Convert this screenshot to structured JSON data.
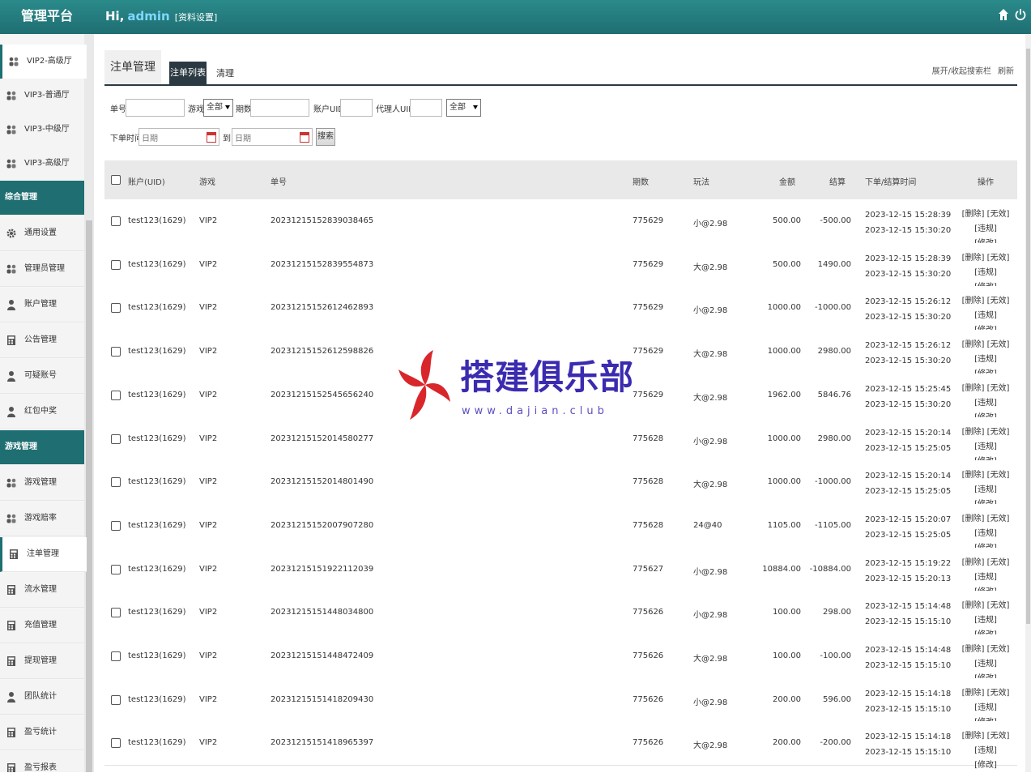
{
  "header": {
    "brand": "管理平台",
    "greeting": "Hi,",
    "user": "admin",
    "profile_link": "[资料设置]"
  },
  "sidebar": {
    "items_top": [
      {
        "label": "VIP2-高级厅",
        "icon": "users-icon"
      },
      {
        "label": "VIP3-普通厅",
        "icon": "users-icon"
      },
      {
        "label": "VIP3-中级厅",
        "icon": "users-icon"
      },
      {
        "label": "VIP3-高级厅",
        "icon": "users-icon"
      }
    ],
    "section1": "综合管理",
    "items_mid": [
      {
        "label": "通用设置",
        "icon": "gear-icon"
      },
      {
        "label": "管理员管理",
        "icon": "users-icon"
      },
      {
        "label": "账户管理",
        "icon": "user-icon"
      },
      {
        "label": "公告管理",
        "icon": "calculator-icon"
      },
      {
        "label": "可疑账号",
        "icon": "user-icon"
      },
      {
        "label": "红包中奖",
        "icon": "user-icon"
      }
    ],
    "section2": "游戏管理",
    "items_bottom": [
      {
        "label": "游戏管理",
        "icon": "users-icon"
      },
      {
        "label": "游戏赔率",
        "icon": "users-icon"
      },
      {
        "label": "注单管理",
        "icon": "calculator-icon"
      },
      {
        "label": "流水管理",
        "icon": "calculator-icon"
      },
      {
        "label": "充值管理",
        "icon": "calculator-icon"
      },
      {
        "label": "提现管理",
        "icon": "calculator-icon"
      },
      {
        "label": "团队统计",
        "icon": "user-icon"
      },
      {
        "label": "盈亏统计",
        "icon": "calculator-icon"
      },
      {
        "label": "盈亏报表",
        "icon": "calculator-icon"
      }
    ]
  },
  "tabs": {
    "title": "注单管理",
    "active": "注单列表",
    "other": "清理",
    "toggle_search": "展开/收起搜索栏",
    "refresh": "刷新"
  },
  "filters": {
    "order_no_label": "单号",
    "game_label": "游戏",
    "game_value": "全部",
    "period_label": "期数",
    "uid_label": "账户UID",
    "agent_label": "代理人UID",
    "type_value": "全部",
    "time_label": "下单时间",
    "date_placeholder": "日期",
    "to_label": "到",
    "search_button": "搜索"
  },
  "table": {
    "headers": [
      "账户(UID)",
      "游戏",
      "单号",
      "期数",
      "玩法",
      "金额",
      "结算",
      "下单/结算时间",
      "操作"
    ],
    "ops": [
      "[删除]",
      "[无效]",
      "[违规]",
      "[修改]"
    ],
    "rows": [
      {
        "account": "test123(1629)",
        "game": "VIP2",
        "order": "20231215152839038465",
        "period": "775629",
        "play": "小@2.98",
        "amount": "500.00",
        "settle": "-500.00",
        "t1": "2023-12-15 15:28:39",
        "t2": "2023-12-15 15:30:20"
      },
      {
        "account": "test123(1629)",
        "game": "VIP2",
        "order": "20231215152839554873",
        "period": "775629",
        "play": "大@2.98",
        "amount": "500.00",
        "settle": "1490.00",
        "t1": "2023-12-15 15:28:39",
        "t2": "2023-12-15 15:30:20"
      },
      {
        "account": "test123(1629)",
        "game": "VIP2",
        "order": "20231215152612462893",
        "period": "775629",
        "play": "小@2.98",
        "amount": "1000.00",
        "settle": "-1000.00",
        "t1": "2023-12-15 15:26:12",
        "t2": "2023-12-15 15:30:20"
      },
      {
        "account": "test123(1629)",
        "game": "VIP2",
        "order": "20231215152612598826",
        "period": "775629",
        "play": "大@2.98",
        "amount": "1000.00",
        "settle": "2980.00",
        "t1": "2023-12-15 15:26:12",
        "t2": "2023-12-15 15:30:20"
      },
      {
        "account": "test123(1629)",
        "game": "VIP2",
        "order": "20231215152545656240",
        "period": "775629",
        "play": "大@2.98",
        "amount": "1962.00",
        "settle": "5846.76",
        "t1": "2023-12-15 15:25:45",
        "t2": "2023-12-15 15:30:20"
      },
      {
        "account": "test123(1629)",
        "game": "VIP2",
        "order": "20231215152014580277",
        "period": "775628",
        "play": "小@2.98",
        "amount": "1000.00",
        "settle": "2980.00",
        "t1": "2023-12-15 15:20:14",
        "t2": "2023-12-15 15:25:05"
      },
      {
        "account": "test123(1629)",
        "game": "VIP2",
        "order": "20231215152014801490",
        "period": "775628",
        "play": "大@2.98",
        "amount": "1000.00",
        "settle": "-1000.00",
        "t1": "2023-12-15 15:20:14",
        "t2": "2023-12-15 15:25:05"
      },
      {
        "account": "test123(1629)",
        "game": "VIP2",
        "order": "20231215152007907280",
        "period": "775628",
        "play": "24@40",
        "amount": "1105.00",
        "settle": "-1105.00",
        "t1": "2023-12-15 15:20:07",
        "t2": "2023-12-15 15:25:05"
      },
      {
        "account": "test123(1629)",
        "game": "VIP2",
        "order": "20231215151922112039",
        "period": "775627",
        "play": "小@2.98",
        "amount": "10884.00",
        "settle": "-10884.00",
        "t1": "2023-12-15 15:19:22",
        "t2": "2023-12-15 15:20:13"
      },
      {
        "account": "test123(1629)",
        "game": "VIP2",
        "order": "20231215151448034800",
        "period": "775626",
        "play": "小@2.98",
        "amount": "100.00",
        "settle": "298.00",
        "t1": "2023-12-15 15:14:48",
        "t2": "2023-12-15 15:15:10"
      },
      {
        "account": "test123(1629)",
        "game": "VIP2",
        "order": "20231215151448472409",
        "period": "775626",
        "play": "大@2.98",
        "amount": "100.00",
        "settle": "-100.00",
        "t1": "2023-12-15 15:14:48",
        "t2": "2023-12-15 15:15:10"
      },
      {
        "account": "test123(1629)",
        "game": "VIP2",
        "order": "20231215151418209430",
        "period": "775626",
        "play": "小@2.98",
        "amount": "200.00",
        "settle": "596.00",
        "t1": "2023-12-15 15:14:18",
        "t2": "2023-12-15 15:15:10"
      },
      {
        "account": "test123(1629)",
        "game": "VIP2",
        "order": "20231215151418965397",
        "period": "775626",
        "play": "大@2.98",
        "amount": "200.00",
        "settle": "-200.00",
        "t1": "2023-12-15 15:14:18",
        "t2": "2023-12-15 15:15:10"
      }
    ]
  },
  "watermark": {
    "title": "搭建俱乐部",
    "url": "www.dajian.club"
  },
  "colors": {
    "header": "#1f6e72",
    "tab_active": "#2b3a42",
    "watermark": "#3b2bb0",
    "logo_red": "#d9262b"
  }
}
